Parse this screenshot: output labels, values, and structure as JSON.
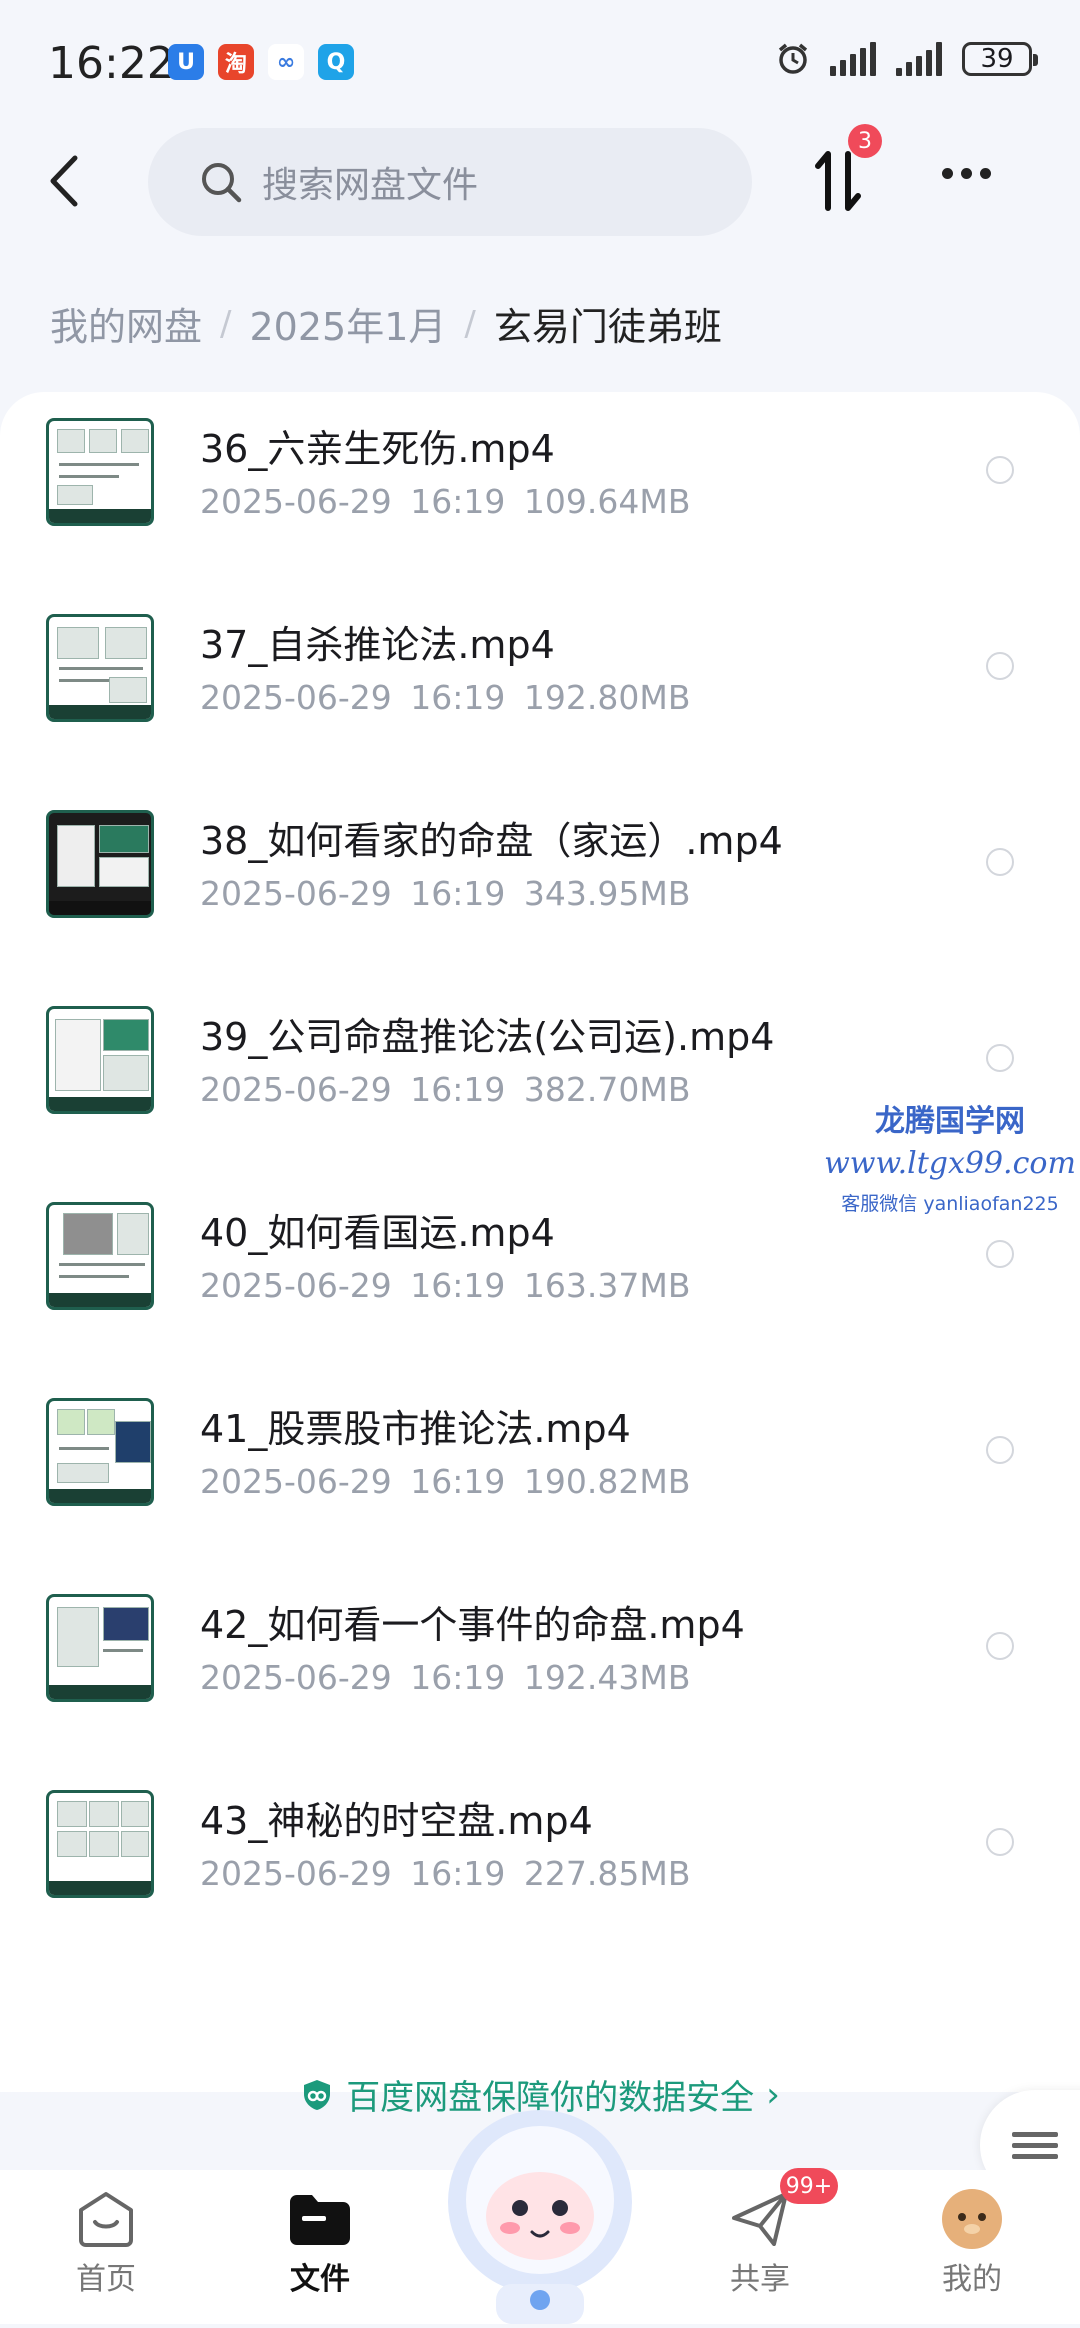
{
  "status_bar": {
    "time": "16:22",
    "battery": "39"
  },
  "header": {
    "search_placeholder": "搜索网盘文件",
    "transfer_badge": "3"
  },
  "breadcrumb": [
    "我的网盘",
    "2025年1月",
    "玄易门徒弟班"
  ],
  "files": [
    {
      "name": "36_六亲生死伤.mp4",
      "date": "2025-06-29",
      "time": "16:19",
      "size": "109.64MB"
    },
    {
      "name": "37_自杀推论法.mp4",
      "date": "2025-06-29",
      "time": "16:19",
      "size": "192.80MB"
    },
    {
      "name": "38_如何看家的命盘（家运）.mp4",
      "date": "2025-06-29",
      "time": "16:19",
      "size": "343.95MB"
    },
    {
      "name": "39_公司命盘推论法(公司运).mp4",
      "date": "2025-06-29",
      "time": "16:19",
      "size": "382.70MB"
    },
    {
      "name": "40_如何看国运.mp4",
      "date": "2025-06-29",
      "time": "16:19",
      "size": "163.37MB"
    },
    {
      "name": "41_股票股市推论法.mp4",
      "date": "2025-06-29",
      "time": "16:19",
      "size": "190.82MB"
    },
    {
      "name": "42_如何看一个事件的命盘.mp4",
      "date": "2025-06-29",
      "time": "16:19",
      "size": "192.43MB"
    },
    {
      "name": "43_神秘的时空盘.mp4",
      "date": "2025-06-29",
      "time": "16:19",
      "size": "227.85MB"
    }
  ],
  "watermark": {
    "line1": "龙腾国学网",
    "line2": "www.ltgx99.com",
    "line3": "客服微信 yanliaofan225"
  },
  "security_banner": "百度网盘保障你的数据安全",
  "bottom_nav": {
    "home": "首页",
    "files": "文件",
    "share": "共享",
    "me": "我的",
    "share_badge": "99+"
  },
  "colors": {
    "accent_green": "#1c9a7c",
    "badge_red": "#f04a5a"
  }
}
